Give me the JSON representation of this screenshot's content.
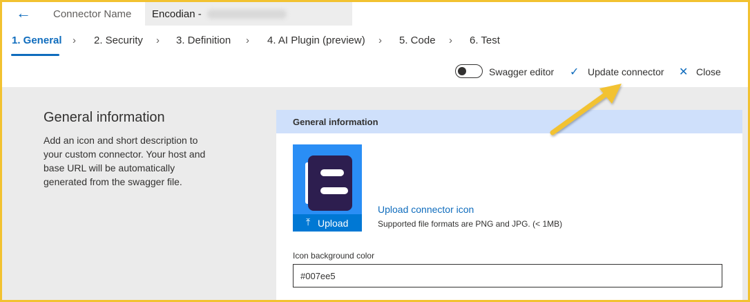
{
  "header": {
    "back_icon": "arrow-left-icon",
    "connector_name_label": "Connector Name",
    "connector_name_value": "Encodian -"
  },
  "steps": [
    {
      "label": "1. General",
      "active": true
    },
    {
      "label": "2. Security"
    },
    {
      "label": "3. Definition"
    },
    {
      "label": "4. AI Plugin (preview)"
    },
    {
      "label": "5. Code"
    },
    {
      "label": "6. Test"
    }
  ],
  "actions": {
    "swagger_editor_label": "Swagger editor",
    "swagger_editor_on": false,
    "update_label": "Update connector",
    "close_label": "Close"
  },
  "left": {
    "title": "General information",
    "description": "Add an icon and short description to your custom connector. Your host and base URL will be automatically generated from the swagger file."
  },
  "card": {
    "header": "General information",
    "upload_button_label": "Upload",
    "upload_link": "Upload connector icon",
    "formats_text": "Supported file formats are PNG and JPG. (< 1MB)",
    "icon_bg_label": "Icon background color",
    "icon_bg_value": "#007ee5"
  },
  "colors": {
    "accent": "#0f6cbd",
    "annotation_arrow": "#f2c230",
    "icon_background": "#2a8ef5",
    "logo": "#2d1e4f"
  }
}
